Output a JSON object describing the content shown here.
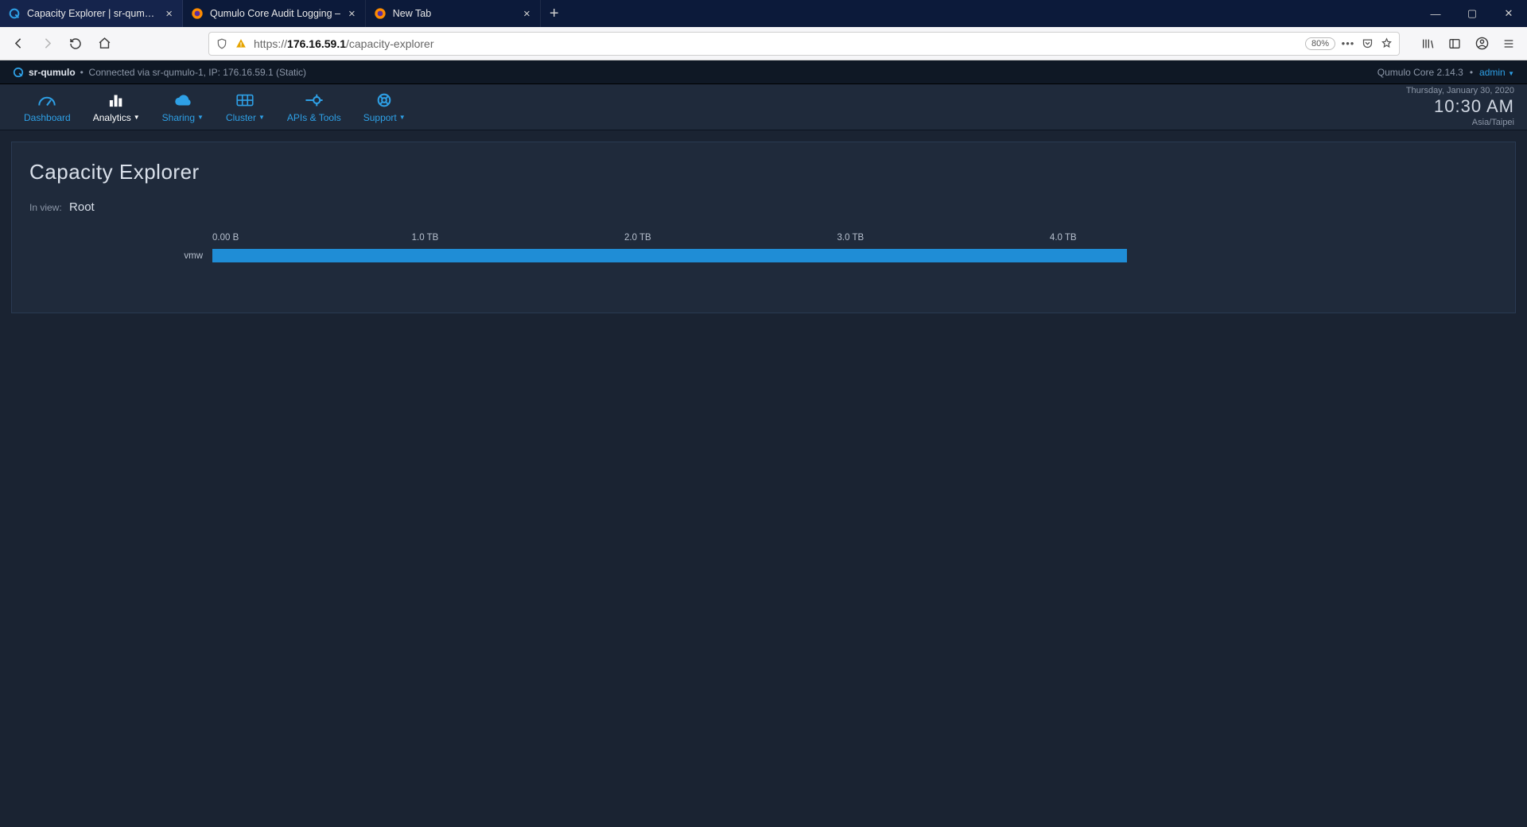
{
  "browser": {
    "tabs": [
      {
        "label": "Capacity Explorer | sr-qumulo",
        "favicon": "qumulo",
        "active": true
      },
      {
        "label": "Qumulo Core Audit Logging – ",
        "favicon": "firefox",
        "active": false
      },
      {
        "label": "New Tab",
        "favicon": "firefox",
        "active": false
      }
    ],
    "url_prefix": "https://",
    "url_host": "176.16.59.1",
    "url_path": "/capacity-explorer",
    "zoom": "80%"
  },
  "statusbar": {
    "host": "sr-qumulo",
    "conn": "Connected via sr-qumulo-1, IP: 176.16.59.1 (Static)",
    "version": "Qumulo Core 2.14.3",
    "user": "admin"
  },
  "menu": {
    "items": [
      {
        "label": "Dashboard",
        "dropdown": false,
        "icon": "gauge"
      },
      {
        "label": "Analytics",
        "dropdown": true,
        "icon": "bars",
        "active": true
      },
      {
        "label": "Sharing",
        "dropdown": true,
        "icon": "cloud"
      },
      {
        "label": "Cluster",
        "dropdown": true,
        "icon": "grid"
      },
      {
        "label": "APIs & Tools",
        "dropdown": false,
        "icon": "plug"
      },
      {
        "label": "Support",
        "dropdown": true,
        "icon": "life-ring"
      }
    ],
    "date": "Thursday, January 30, 2020",
    "time": "10:30 AM",
    "tz": "Asia/Taipei"
  },
  "page": {
    "title": "Capacity Explorer",
    "inview_label": "In view:",
    "inview_value": "Root"
  },
  "chart_data": {
    "type": "bar",
    "orientation": "horizontal",
    "xlabel": "",
    "ylabel": "",
    "xlim": [
      0,
      4.3
    ],
    "unit": "TB",
    "ticks": [
      {
        "pos": 0.0,
        "label": "0.00 B"
      },
      {
        "pos": 1.0,
        "label": "1.0 TB"
      },
      {
        "pos": 2.0,
        "label": "2.0 TB"
      },
      {
        "pos": 3.0,
        "label": "3.0 TB"
      },
      {
        "pos": 4.0,
        "label": "4.0 TB"
      }
    ],
    "categories": [
      "vmw"
    ],
    "values": [
      4.3
    ]
  }
}
